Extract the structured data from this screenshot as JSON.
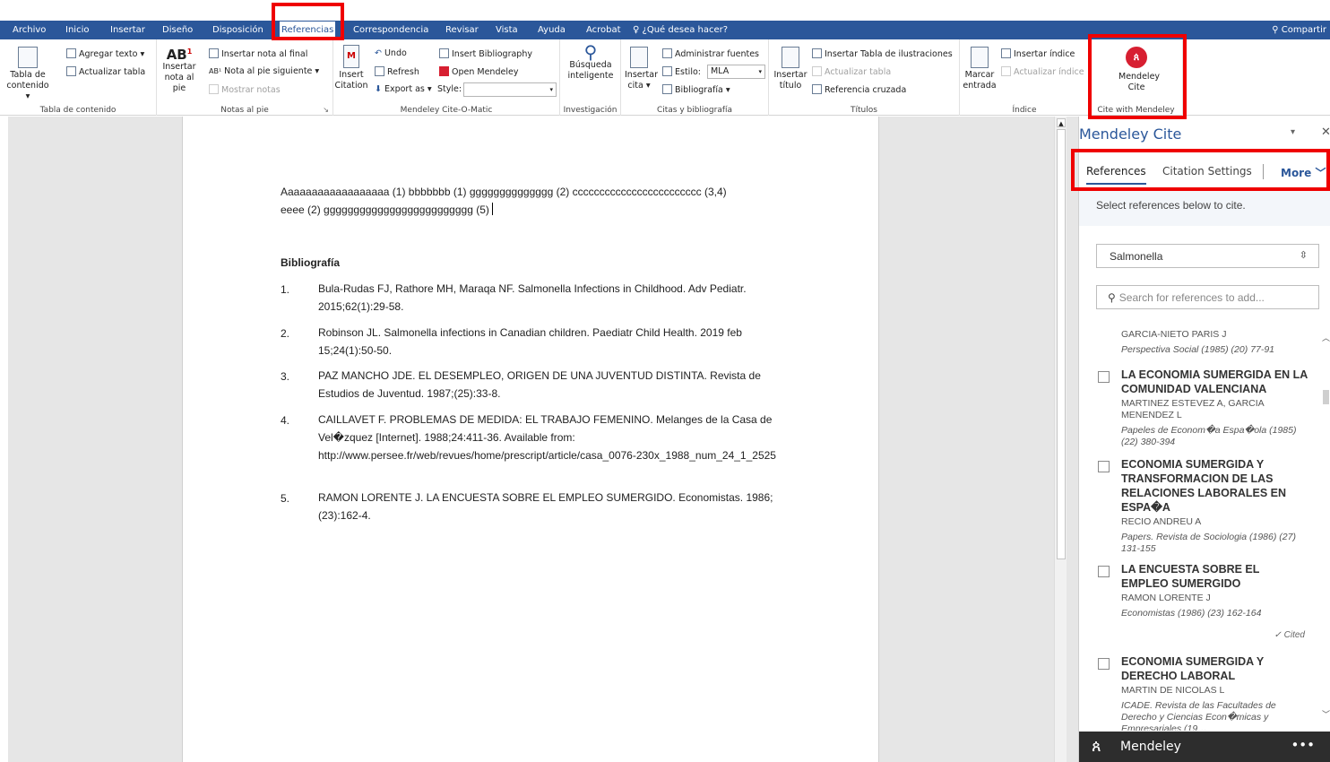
{
  "tabs": [
    "Archivo",
    "Inicio",
    "Insertar",
    "Diseño",
    "Disposición",
    "Referencias",
    "Correspondencia",
    "Revisar",
    "Vista",
    "Ayuda",
    "Acrobat",
    "¿Qué desea hacer?"
  ],
  "share": "Compartir",
  "ribbon": {
    "toc": {
      "big": "Tabla de contenido",
      "add_text": "Agregar texto",
      "update": "Actualizar tabla",
      "group": "Tabla de contenido"
    },
    "notes": {
      "big": "Insertar nota al pie",
      "endnote": "Insertar nota al final",
      "next": "Nota al pie siguiente",
      "show": "Mostrar notas",
      "group": "Notas al pie"
    },
    "mendeley": {
      "big": "Insert Citation",
      "undo": "Undo",
      "refresh": "Refresh",
      "export": "Export as",
      "insert_bib": "Insert Bibliography",
      "open": "Open Mendeley",
      "style_label": "Style:",
      "style_value": "",
      "group": "Mendeley Cite-O-Matic"
    },
    "research": {
      "big": "Búsqueda inteligente",
      "group": "Investigación"
    },
    "citations": {
      "big": "Insertar cita",
      "manage": "Administrar fuentes",
      "style_label": "Estilo:",
      "style_value": "MLA",
      "bib": "Bibliografía",
      "group": "Citas y bibliografía"
    },
    "captions": {
      "big": "Insertar título",
      "table_fig": "Insertar Tabla de ilustraciones",
      "update": "Actualizar tabla",
      "cross": "Referencia cruzada",
      "group": "Títulos"
    },
    "index": {
      "big": "Marcar entrada",
      "insert": "Insertar índice",
      "update": "Actualizar índice",
      "group": "Índice"
    },
    "cite": {
      "big": "Mendeley Cite",
      "group": "Cite with Mendeley"
    }
  },
  "document": {
    "line1": "Aaaaaaaaaaaaaaaaaa (1) bbbbbbb (1)  gggggggggggggg (2) cccccccccccccccccccccccc (3,4)",
    "line2": "eeee (2) ggggggggggggggggggggggggg (5)",
    "bib_heading": "Bibliografía",
    "refs": [
      {
        "n": "1.",
        "text": "Bula-Rudas FJ, Rathore MH, Maraqa NF. Salmonella Infections in Childhood. Adv Pediatr. 2015;62(1):29-58."
      },
      {
        "n": "2.",
        "text": "Robinson JL. Salmonella infections in Canadian children. Paediatr Child Health. 2019 feb 15;24(1):50-50."
      },
      {
        "n": "3.",
        "text": "PAZ MANCHO JDE. EL DESEMPLEO, ORIGEN DE UNA JUVENTUD DISTINTA. Revista de Estudios de Juventud. 1987;(25):33-8."
      },
      {
        "n": "4.",
        "text": "CAILLAVET F. PROBLEMAS DE MEDIDA: EL TRABAJO FEMENINO. Melanges de la Casa de Vel�zquez [Internet]. 1988;24:411-36. Available from: http://www.persee.fr/web/revues/home/prescript/article/casa_0076-230x_1988_num_24_1_2525"
      },
      {
        "n": "5.",
        "text": "RAMON LORENTE J. LA ENCUESTA SOBRE EL EMPLEO SUMERGIDO. Economistas. 1986;(23):162-4."
      }
    ]
  },
  "pane": {
    "title": "Mendeley Cite",
    "tabs": {
      "references": "References",
      "settings": "Citation Settings",
      "more": "More"
    },
    "hint": "Select references below to cite.",
    "group_value": "Salmonella",
    "search_placeholder": "Search for references to add...",
    "items": [
      {
        "title": "",
        "authors": "GARCIA-NIETO PARIS J",
        "pub": "Perspectiva Social (1985) (20) 77-91",
        "cited": ""
      },
      {
        "title": "LA ECONOMIA SUMERGIDA EN LA COMUNIDAD VALENCIANA",
        "authors": "MARTINEZ ESTEVEZ A, GARCIA MENENDEZ L",
        "pub": "Papeles de Econom�a Espa�ola (1985) (22) 380-394",
        "cited": ""
      },
      {
        "title": "ECONOMIA SUMERGIDA Y TRANSFORMACION DE LAS RELACIONES LABORALES EN ESPA�A",
        "authors": "RECIO ANDREU A",
        "pub": "Papers. Revista de Sociologia (1986) (27) 131-155",
        "cited": ""
      },
      {
        "title": "LA ENCUESTA SOBRE EL EMPLEO SUMERGIDO",
        "authors": "RAMON LORENTE J",
        "pub": "Economistas (1986) (23) 162-164",
        "cited": "✓ Cited"
      },
      {
        "title": "ECONOMIA SUMERGIDA Y DERECHO LABORAL",
        "authors": "MARTIN DE NICOLAS L",
        "pub": "ICADE. Revista de las Facultades de Derecho y Ciencias Econ�micas y Empresariales (19…",
        "cited": ""
      }
    ],
    "footer": "Mendeley",
    "footer_more": "•••"
  },
  "colors": {
    "accent": "#2b579a",
    "highlight": "#ef0000",
    "mendeley_red": "#d71f31",
    "footer": "#2d2d2d"
  }
}
